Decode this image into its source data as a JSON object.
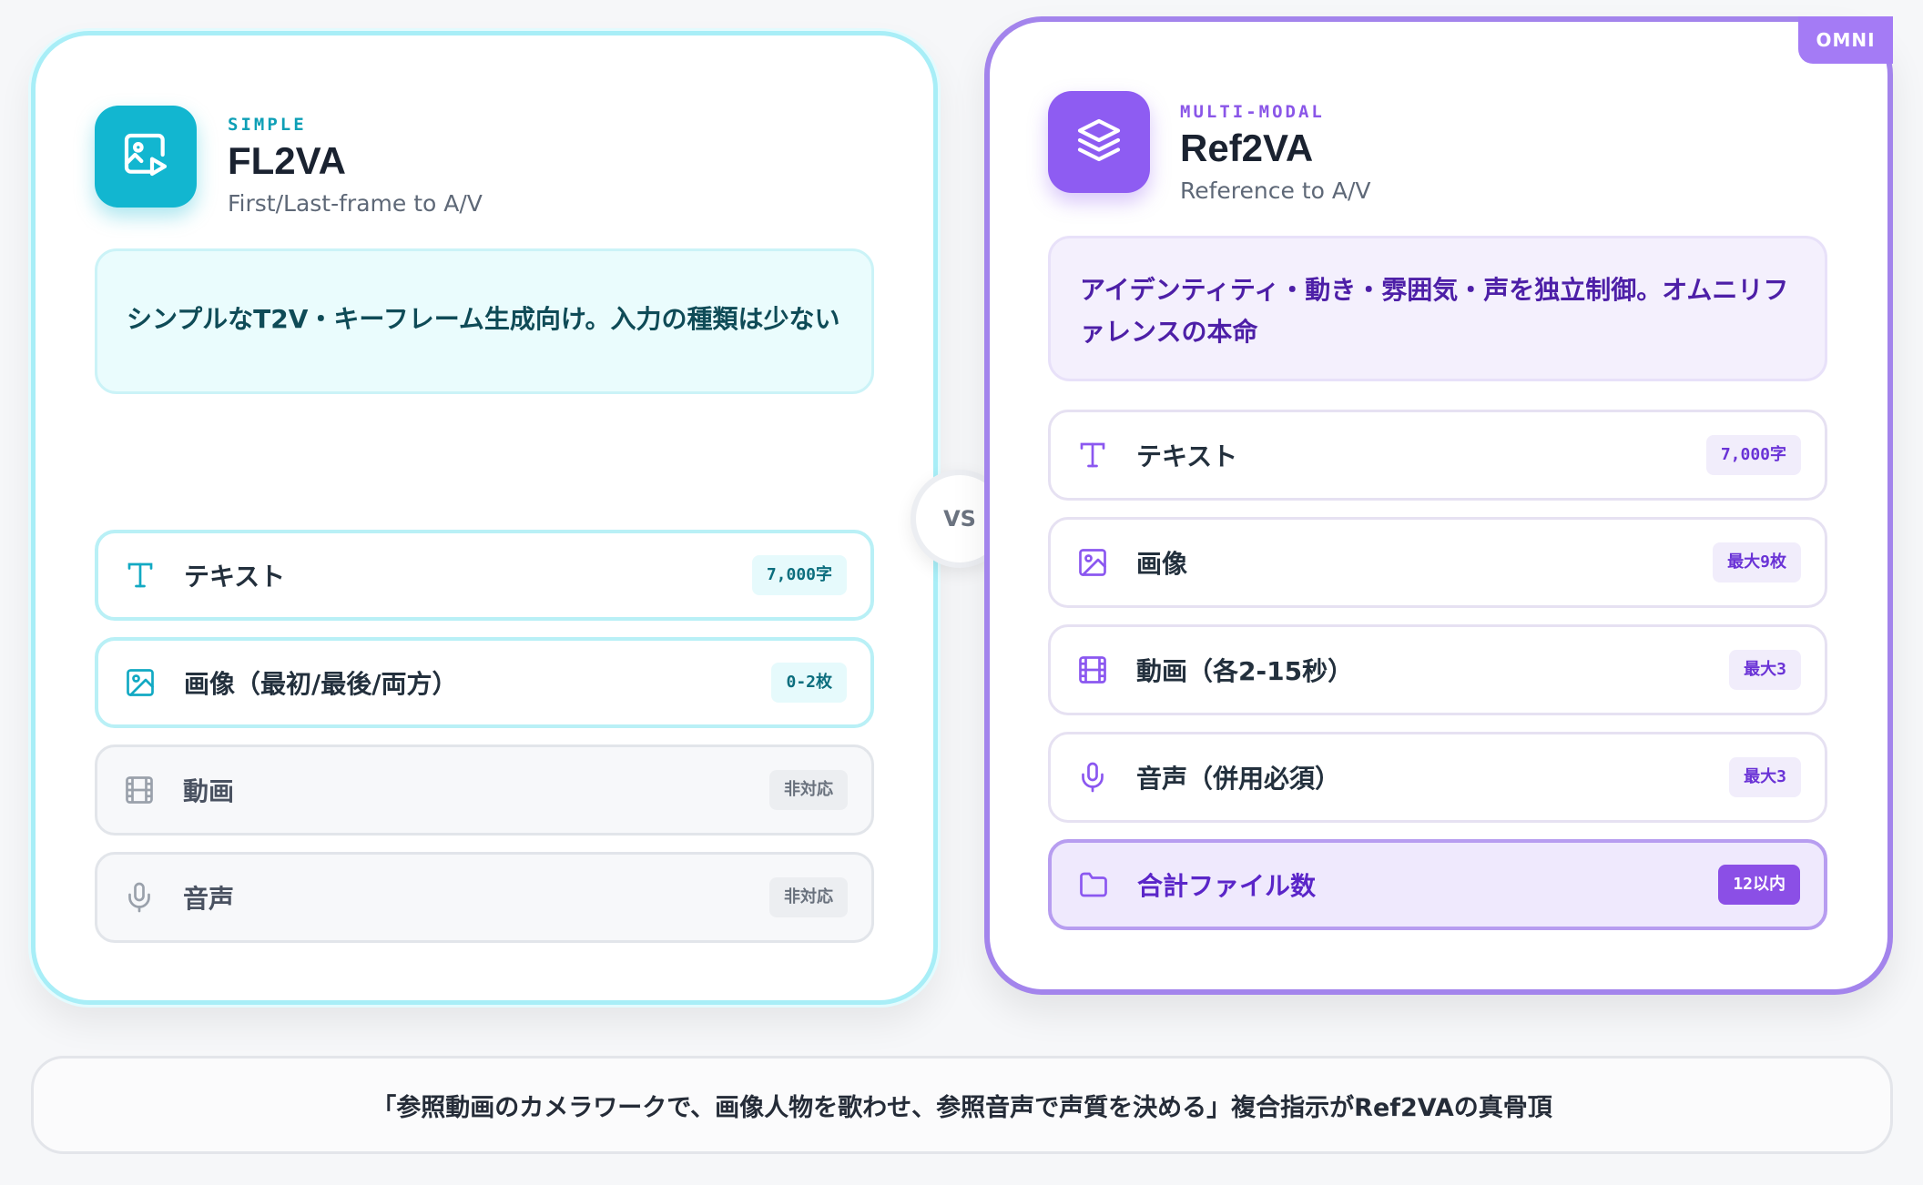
{
  "left": {
    "kicker": "SIMPLE",
    "title": "FL2VA",
    "subtitle": "First/Last-frame to A/V",
    "description": "シンプルなT2V・キーフレーム生成向け。入力の種類は少ない",
    "accent": "#0bb4cf",
    "logo_icon": "image-play-icon",
    "rows": [
      {
        "icon": "text-icon",
        "label": "テキスト",
        "badge": "7,000字",
        "supported": true
      },
      {
        "icon": "image-icon",
        "label": "画像（最初/最後/両方）",
        "badge": "0-2枚",
        "supported": true
      },
      {
        "icon": "film-icon",
        "label": "動画",
        "badge": "非対応",
        "supported": false
      },
      {
        "icon": "mic-icon",
        "label": "音声",
        "badge": "非対応",
        "supported": false
      }
    ]
  },
  "vs": "VS",
  "right": {
    "corner_badge": "OMNI",
    "kicker": "MULTI-MODAL",
    "title": "Ref2VA",
    "subtitle": "Reference to A/V",
    "description": "アイデンティティ・動き・雰囲気・声を独立制御。オムニリファレンスの本命",
    "accent": "#8b57f0",
    "logo_icon": "layers-icon",
    "rows": [
      {
        "icon": "text-icon",
        "label": "テキスト",
        "badge": "7,000字"
      },
      {
        "icon": "image-icon",
        "label": "画像",
        "badge": "最大9枚"
      },
      {
        "icon": "film-icon",
        "label": "動画（各2-15秒）",
        "badge": "最大3"
      },
      {
        "icon": "mic-icon",
        "label": "音声（併用必須）",
        "badge": "最大3"
      },
      {
        "icon": "folder-icon",
        "label": "合計ファイル数",
        "badge": "12以内"
      }
    ]
  },
  "footer": "「参照動画のカメラワークで、画像人物を歌わせ、参照音声で声質を決める」複合指示がRef2VAの真骨頂"
}
